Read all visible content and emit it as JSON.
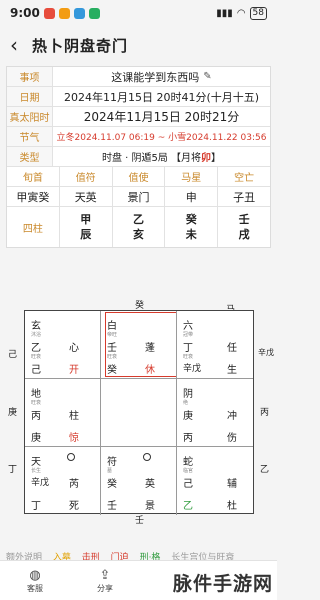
{
  "status": {
    "time": "9:00",
    "battery": "58"
  },
  "nav": {
    "title": "热卜阴盘奇门"
  },
  "info": {
    "matter_label": "事项",
    "matter_value": "这课能学到东西吗",
    "date_label": "日期",
    "date_value": "2024年11月15日 20时41分(十月十五)",
    "solar_label": "真太阳时",
    "solar_value": "2024年11月15日 20时21分",
    "term_label": "节气",
    "term_value": "立冬2024.11.07 06:19 ~ 小雪2024.11.22 03:56",
    "type_label": "类型",
    "type_prefix": "时盘 · 阴遁5局 【月将",
    "type_god": "卯",
    "type_suffix": "】",
    "header_cells": [
      "旬首",
      "值符",
      "值使",
      "马星",
      "空亡"
    ],
    "values_cells": [
      "甲寅癸",
      "天英",
      "景门",
      "申",
      "子丑"
    ],
    "pillar_label": "四柱",
    "pillars": [
      {
        "top": "甲",
        "bottom": "辰"
      },
      {
        "top": "乙",
        "bottom": "亥"
      },
      {
        "top": "癸",
        "bottom": "未"
      },
      {
        "top": "壬",
        "bottom": "戌"
      }
    ]
  },
  "board": {
    "top_label": "癸",
    "top_right_label": "马",
    "bottom_label": "壬",
    "left_top": "己",
    "left_mid": "庚",
    "left_bot": "丁",
    "right_top": "辛戊",
    "right_mid": "丙",
    "right_bot": "乙",
    "cells": [
      {
        "god": "玄",
        "star": "心",
        "door": "开",
        "stem1": "乙",
        "stem2": "己",
        "small1": "沐浴",
        "small2": "旺衰"
      },
      {
        "god": "白",
        "star": "蓬",
        "door": "休",
        "stem1": "壬",
        "stem2": "癸",
        "small1": "帝旺",
        "small2": "旺衰"
      },
      {
        "god": "六",
        "star": "任",
        "door": "生",
        "stem1": "丁",
        "stem2": "辛戊",
        "small1": "冠带",
        "small2": "旺衰"
      },
      {
        "god": "地",
        "star": "柱",
        "door": "惊",
        "stem1": "丙",
        "stem2": "庚",
        "small1": "旺衰",
        "small2": ""
      },
      {
        "god": "阴",
        "star": "冲",
        "door": "伤",
        "stem1": "庚",
        "stem2": "丙",
        "small1": "绝",
        "small2": ""
      },
      {
        "god": "天",
        "star": "芮",
        "door": "死",
        "stem1": "辛戊",
        "stem2": "丁",
        "small1": "长生",
        "small2": ""
      },
      {
        "god": "符",
        "star": "英",
        "door": "景",
        "stem1": "癸",
        "stem2": "壬",
        "small1": "墓",
        "small2": ""
      },
      {
        "god": "蛇",
        "star": "辅",
        "door": "杜",
        "stem1": "己",
        "stem2": "乙",
        "small1": "临官",
        "small2": ""
      }
    ]
  },
  "legend": {
    "items": [
      "额外说明",
      "入墓",
      "击刑",
      "门迫",
      "刑·格",
      "长生宫位与旺衰"
    ]
  },
  "tabs": {
    "home": "客服",
    "share": "分享"
  },
  "watermark": "脉件手游网"
}
